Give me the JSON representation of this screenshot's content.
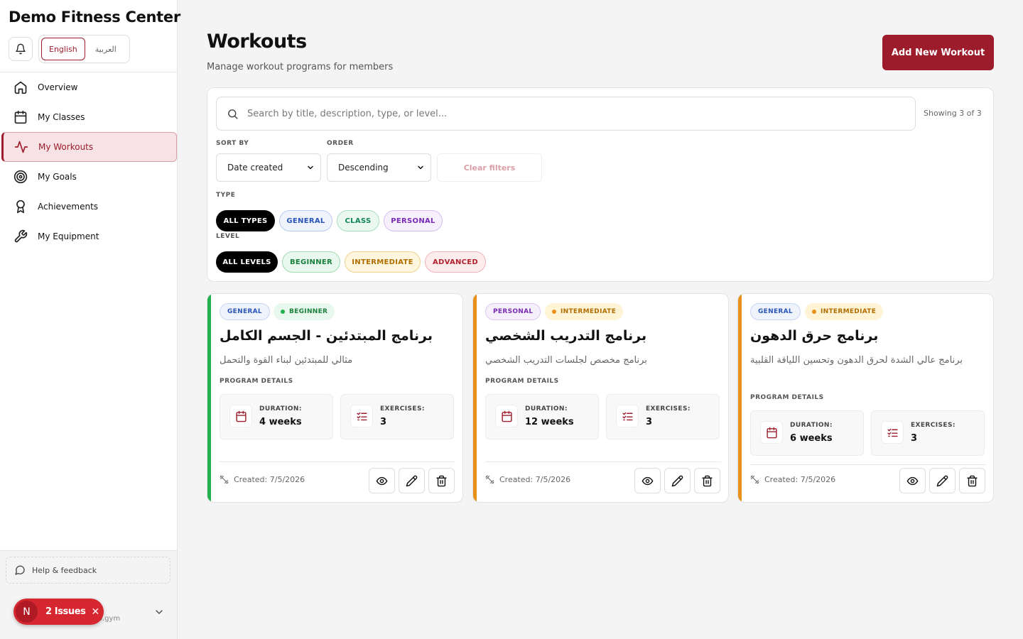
{
  "sidebar": {
    "brand": "Demo Fitness Center",
    "lang": {
      "english": "English",
      "arabic": "العربية"
    },
    "items": [
      {
        "label": "Overview",
        "icon": "home-icon"
      },
      {
        "label": "My Classes",
        "icon": "calendar-icon"
      },
      {
        "label": "My Workouts",
        "icon": "activity-icon",
        "active": true
      },
      {
        "label": "My Goals",
        "icon": "target-icon"
      },
      {
        "label": "Achievements",
        "icon": "award-icon"
      },
      {
        "label": "My Equipment",
        "icon": "wrench-icon"
      }
    ],
    "help": "Help & feedback",
    "user_email_fragment": "o.gym"
  },
  "issues_badge": {
    "letter": "N",
    "label": "2 Issues",
    "close": "✕"
  },
  "header": {
    "title": "Workouts",
    "subtitle": "Manage workout programs for members",
    "add_button": "Add New Workout"
  },
  "filters": {
    "search_placeholder": "Search by title, description, type, or level...",
    "showing": "Showing 3 of 3",
    "sort_by_label": "SORT BY",
    "sort_by_value": "Date created",
    "order_label": "ORDER",
    "order_value": "Descending",
    "clear": "Clear filters",
    "type_label": "TYPE",
    "types": [
      "ALL TYPES",
      "GENERAL",
      "CLASS",
      "PERSONAL"
    ],
    "level_label": "LEVEL",
    "levels": [
      "ALL LEVELS",
      "BEGINNER",
      "INTERMEDIATE",
      "ADVANCED"
    ]
  },
  "cards": [
    {
      "type": "GENERAL",
      "level": "BEGINNER",
      "title": "برنامج المبتدئين - الجسم الكامل",
      "description": "مثالي للمبتدئين لبناء القوة والتحمل",
      "details_label": "PROGRAM DETAILS",
      "duration_label": "DURATION:",
      "duration": "4 weeks",
      "exercises_label": "EXERCISES:",
      "exercises": "3",
      "created": "Created: 7/5/2026",
      "accent": "#22b14c"
    },
    {
      "type": "PERSONAL",
      "level": "INTERMEDIATE",
      "title": "برنامج التدريب الشخصي",
      "description": "برنامج مخصص لجلسات التدريب الشخصي",
      "details_label": "PROGRAM DETAILS",
      "duration_label": "DURATION:",
      "duration": "12 weeks",
      "exercises_label": "EXERCISES:",
      "exercises": "3",
      "created": "Created: 7/5/2026",
      "accent": "#e8901a"
    },
    {
      "type": "GENERAL",
      "level": "INTERMEDIATE",
      "title": "برنامج حرق الدهون",
      "description": "برنامج عالي الشدة لحرق الدهون وتحسين اللياقة القلبية",
      "details_label": "PROGRAM DETAILS",
      "duration_label": "DURATION:",
      "duration": "6 weeks",
      "exercises_label": "EXERCISES:",
      "exercises": "3",
      "created": "Created: 7/5/2026",
      "accent": "#e8901a"
    }
  ],
  "colors": {
    "brand": "#9c1c2c",
    "general": "#2a55b8",
    "class": "#13845a",
    "personal": "#7a2bb5",
    "beginner": "#19813d",
    "intermediate": "#b06d00",
    "advanced": "#b3232f"
  }
}
